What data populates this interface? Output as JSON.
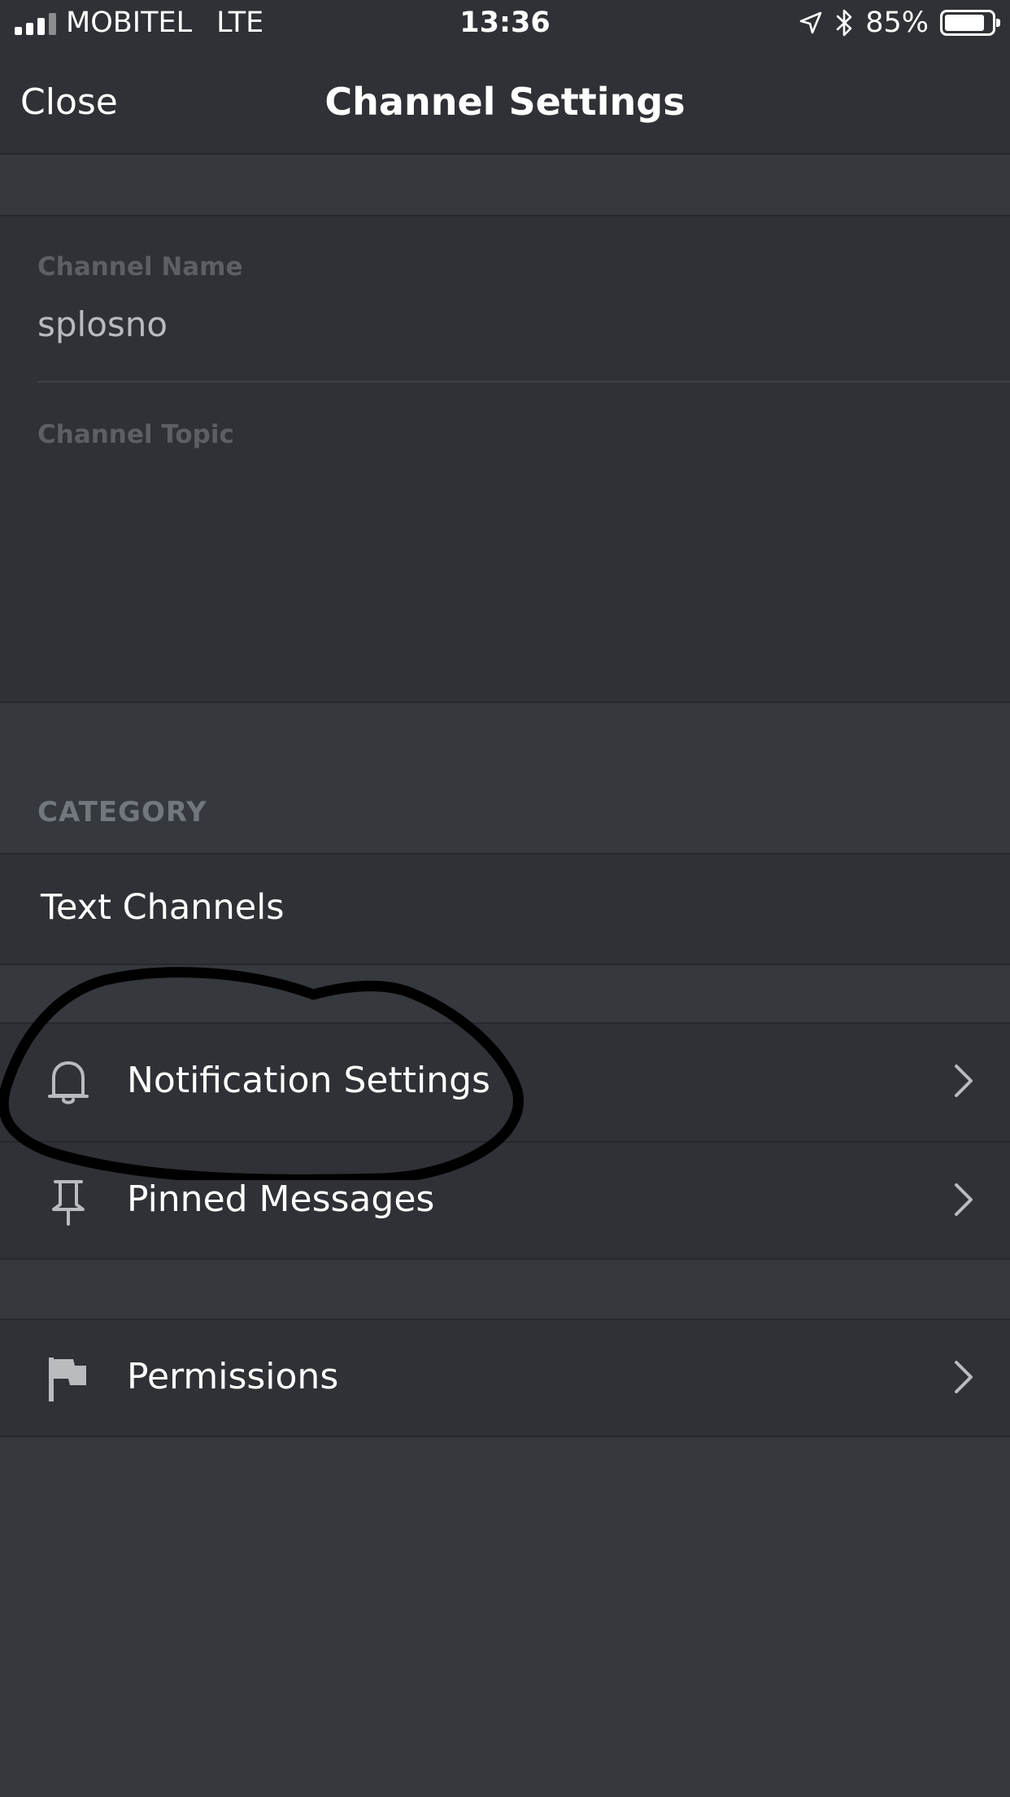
{
  "status_bar": {
    "carrier": "MOBITEL",
    "network": "LTE",
    "time": "13:36",
    "battery": "85%",
    "battery_level": 0.85,
    "icons": [
      "signal-icon",
      "location-arrow-icon",
      "bluetooth-icon",
      "battery-icon"
    ]
  },
  "nav": {
    "close_label": "Close",
    "title": "Channel Settings"
  },
  "channel": {
    "name_label": "Channel Name",
    "name_value": "splosno",
    "topic_label": "Channel Topic",
    "topic_value": ""
  },
  "category": {
    "header": "CATEGORY",
    "value": "Text Channels"
  },
  "menu": {
    "items": [
      {
        "label": "Notification Settings",
        "icon": "bell-icon"
      },
      {
        "label": "Pinned Messages",
        "icon": "pin-icon"
      }
    ],
    "permissions": {
      "label": "Permissions",
      "icon": "flag-icon"
    }
  },
  "colors": {
    "background": "#35383d",
    "panel": "#2f3136",
    "text": "#ffffff",
    "muted_label": "#5c5f64",
    "icon": "#b9bbbe"
  }
}
